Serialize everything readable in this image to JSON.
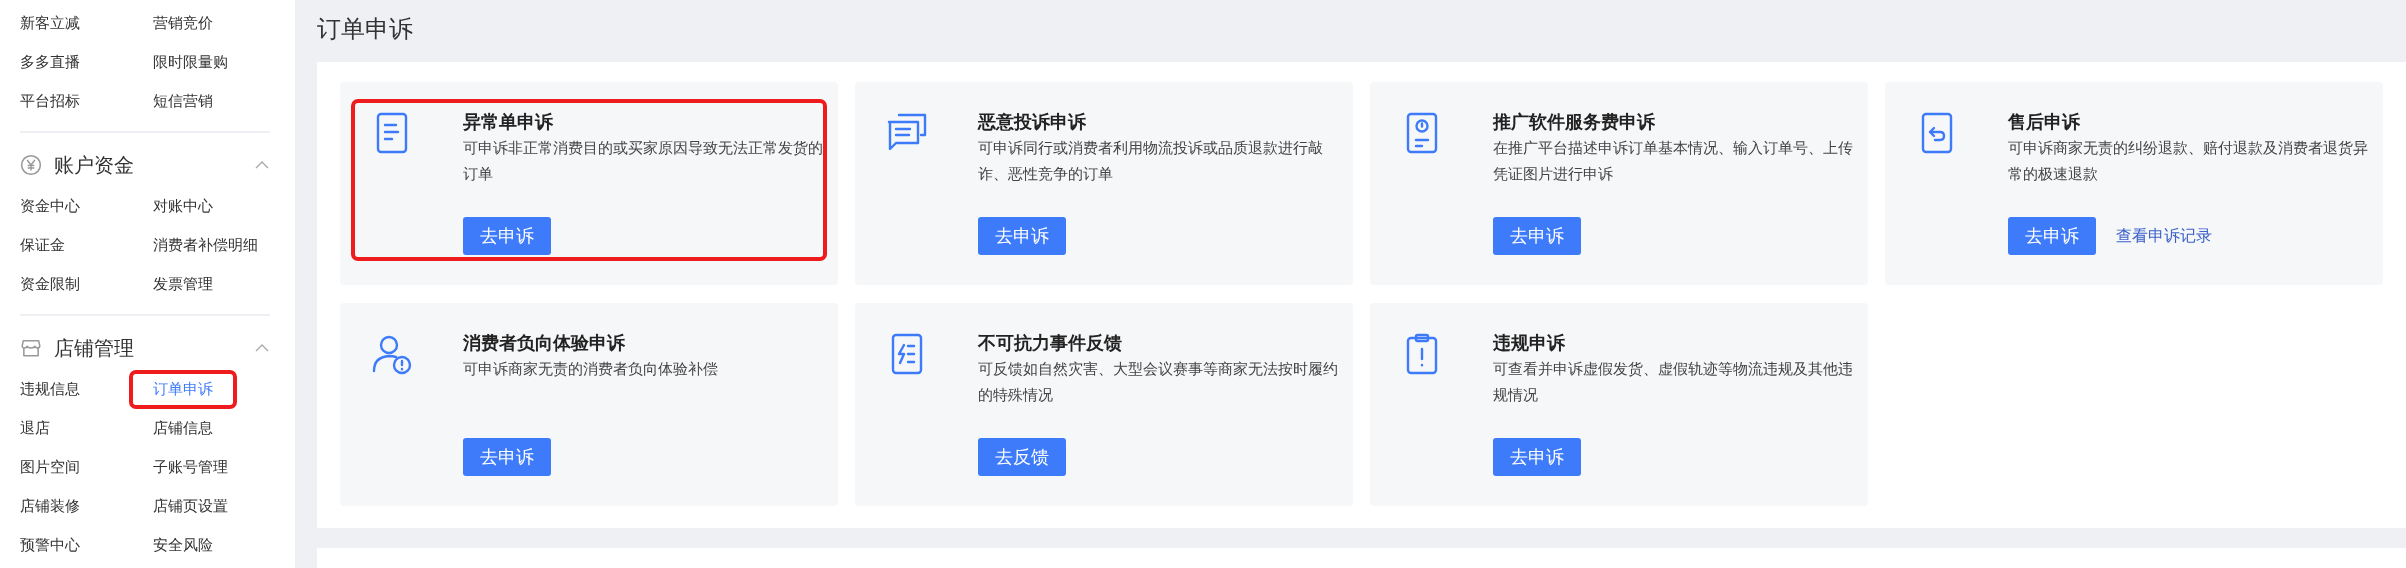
{
  "sidebar": {
    "groups": [
      {
        "items": [
          {
            "label": "新客立减",
            "selected": false,
            "highlighted": false
          },
          {
            "label": "营销竞价",
            "selected": false,
            "highlighted": false
          },
          {
            "label": "多多直播",
            "selected": false,
            "highlighted": false
          },
          {
            "label": "限时限量购",
            "selected": false,
            "highlighted": false
          },
          {
            "label": "平台招标",
            "selected": false,
            "highlighted": false
          },
          {
            "label": "短信营销",
            "selected": false,
            "highlighted": false
          }
        ]
      },
      {
        "title": "账户资金",
        "expanded": true,
        "items": [
          {
            "label": "资金中心",
            "selected": false,
            "highlighted": false
          },
          {
            "label": "对账中心",
            "selected": false,
            "highlighted": false
          },
          {
            "label": "保证金",
            "selected": false,
            "highlighted": false
          },
          {
            "label": "消费者补偿明细",
            "selected": false,
            "highlighted": false
          },
          {
            "label": "资金限制",
            "selected": false,
            "highlighted": false
          },
          {
            "label": "发票管理",
            "selected": false,
            "highlighted": false
          }
        ]
      },
      {
        "title": "店铺管理",
        "expanded": true,
        "items": [
          {
            "label": "违规信息",
            "selected": false,
            "highlighted": false
          },
          {
            "label": "订单申诉",
            "selected": true,
            "highlighted": true
          },
          {
            "label": "退店",
            "selected": false,
            "highlighted": false
          },
          {
            "label": "店铺信息",
            "selected": false,
            "highlighted": false
          },
          {
            "label": "图片空间",
            "selected": false,
            "highlighted": false
          },
          {
            "label": "子账号管理",
            "selected": false,
            "highlighted": false
          },
          {
            "label": "店铺装修",
            "selected": false,
            "highlighted": false
          },
          {
            "label": "店铺页设置",
            "selected": false,
            "highlighted": false
          },
          {
            "label": "预警中心",
            "selected": false,
            "highlighted": false
          },
          {
            "label": "安全风险",
            "selected": false,
            "highlighted": false
          }
        ]
      }
    ]
  },
  "page_title": "订单申诉",
  "cards": [
    {
      "title": "异常单申诉",
      "description": "可申诉非正常消费目的或买家原因导致无法正常发货的订单",
      "button": "去申诉",
      "highlighted": true
    },
    {
      "title": "恶意投诉申诉",
      "description": "可申诉同行或消费者利用物流投诉或品质退款进行敲诈、恶性竞争的订单",
      "button": "去申诉",
      "highlighted": false
    },
    {
      "title": "推广软件服务费申诉",
      "description": "在推广平台描述申诉订单基本情况、输入订单号、上传凭证图片进行申诉",
      "button": "去申诉",
      "highlighted": false
    },
    {
      "title": "售后申诉",
      "description": "可申诉商家无责的纠纷退款、赔付退款及消费者退货异常的极速退款",
      "button": "去申诉",
      "link": "查看申诉记录",
      "highlighted": false
    },
    {
      "title": "消费者负向体验申诉",
      "description": "可申诉商家无责的消费者负向体验补偿",
      "button": "去申诉",
      "highlighted": false
    },
    {
      "title": "不可抗力事件反馈",
      "description": "可反馈如自然灾害、大型会议赛事等商家无法按时履约的特殊情况",
      "button": "去反馈",
      "highlighted": false
    },
    {
      "title": "违规申诉",
      "description": "可查看并申诉虚假发货、虚假轨迹等物流违规及其他违规情况",
      "button": "去申诉",
      "highlighted": false
    }
  ]
}
